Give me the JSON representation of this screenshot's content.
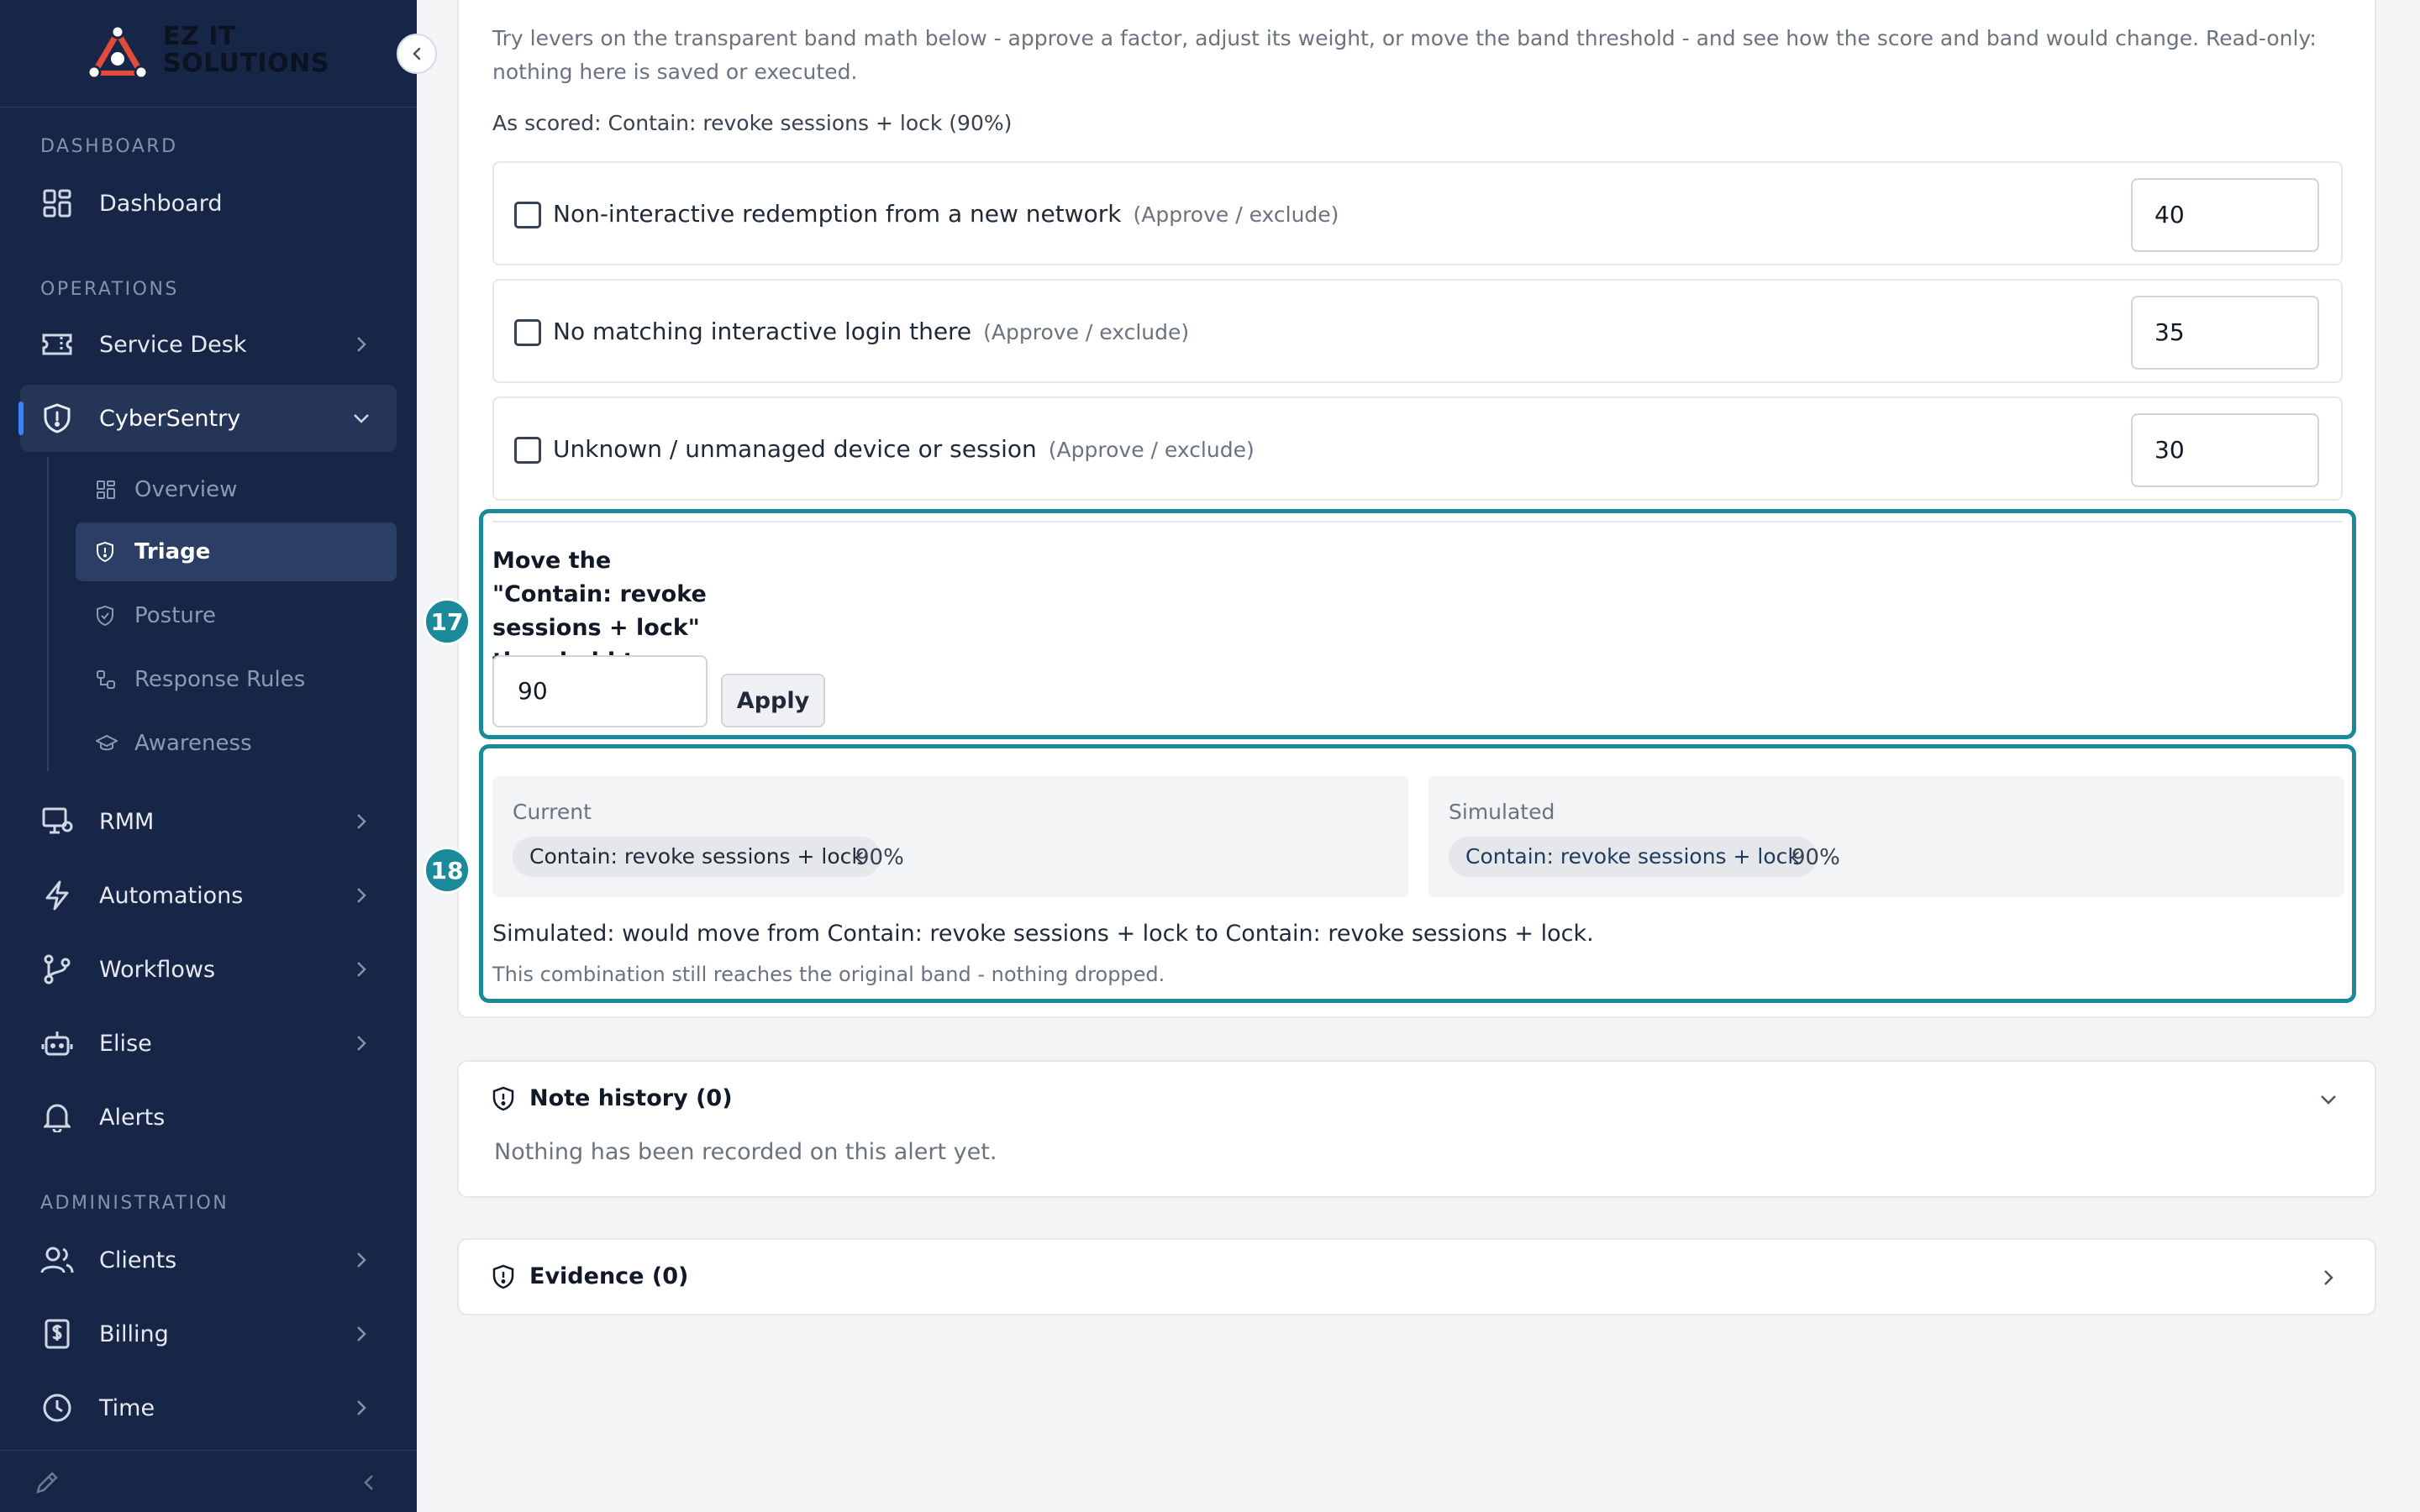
{
  "brand": {
    "name_line1": "EZ IT",
    "name_line2": "SOLUTIONS"
  },
  "sidebar": {
    "sections": {
      "dashboard": "DASHBOARD",
      "operations": "OPERATIONS",
      "administration": "ADMINISTRATION"
    },
    "items": {
      "dashboard": "Dashboard",
      "service_desk": "Service Desk",
      "cybersentry": "CyberSentry",
      "rmm": "RMM",
      "automations": "Automations",
      "workflows": "Workflows",
      "elise": "Elise",
      "alerts": "Alerts",
      "clients": "Clients",
      "billing": "Billing",
      "time": "Time"
    },
    "subitems": {
      "overview": "Overview",
      "triage": "Triage",
      "posture": "Posture",
      "response_rules": "Response Rules",
      "awareness": "Awareness"
    }
  },
  "simulator": {
    "intro": "Try levers on the transparent band math below - approve a factor, adjust its weight, or move the band threshold - and see how the score and band would change. Read-only: nothing here is saved or executed.",
    "as_scored": "As scored: Contain: revoke sessions + lock (90%)",
    "factors": [
      {
        "label": "Non-interactive redemption from a new network",
        "hint": "(Approve / exclude)",
        "weight": "40",
        "checked": false
      },
      {
        "label": "No matching interactive login there",
        "hint": "(Approve / exclude)",
        "weight": "35",
        "checked": false
      },
      {
        "label": "Unknown / unmanaged device or session",
        "hint": "(Approve / exclude)",
        "weight": "30",
        "checked": false
      }
    ],
    "threshold": {
      "title": "Move the \"Contain: revoke sessions + lock\" threshold to",
      "value": "90",
      "apply_label": "Apply"
    },
    "current": {
      "label": "Current",
      "band": "Contain: revoke sessions + lock",
      "pct": "90%"
    },
    "simulated": {
      "label": "Simulated",
      "band": "Contain: revoke sessions + lock",
      "pct": "90%"
    },
    "result_text": "Simulated: would move from Contain: revoke sessions + lock to Contain: revoke sessions + lock.",
    "result_sub": "This combination still reaches the original band - nothing dropped.",
    "markers": {
      "threshold": "17",
      "result": "18"
    }
  },
  "note_history": {
    "title": "Note history (0)",
    "empty": "Nothing has been recorded on this alert yet."
  },
  "evidence": {
    "title": "Evidence (0)"
  },
  "colors": {
    "sidebar_bg": "#172646",
    "highlight": "#1a8a9a",
    "accent": "#3b82f6"
  }
}
